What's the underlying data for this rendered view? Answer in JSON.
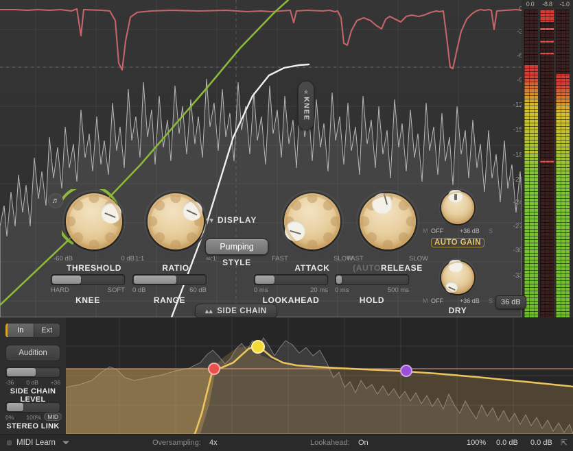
{
  "meters": {
    "values": [
      "0.0",
      "-8.8",
      "-1.0"
    ],
    "scale_labels": [
      "0",
      "-3",
      "-6",
      "-9",
      "-12",
      "-15",
      "-18",
      "-21",
      "-24",
      "-27",
      "-30",
      "-33"
    ],
    "gain_badge": "36 dB"
  },
  "graph": {
    "knee_tab_label": "KNEE",
    "knee_tab_icon": "chevron-double-left-icon",
    "headphone_icon": "headphone-icon"
  },
  "controls": {
    "threshold": {
      "name": "THRESHOLD",
      "min": "-60 dB",
      "max": "0 dB"
    },
    "ratio": {
      "name": "RATIO",
      "min": "1:1",
      "max": "∞:1"
    },
    "attack": {
      "name": "ATTACK",
      "min": "FAST",
      "max": "SLOW"
    },
    "release": {
      "name": "RELEASE",
      "prefix": "(AUTO",
      "min": "FAST",
      "max": "SLOW"
    },
    "knee": {
      "name": "KNEE",
      "min": "HARD",
      "max": "SOFT"
    },
    "range": {
      "name": "RANGE",
      "min": "0 dB",
      "max": "60 dB"
    },
    "lookahead": {
      "name": "LOOKAHEAD",
      "min": "0 ms",
      "max": "20 ms"
    },
    "hold": {
      "name": "HOLD",
      "min": "0 ms",
      "max": "500 ms"
    },
    "style": {
      "name": "STYLE",
      "value": "Pumping"
    },
    "auto_gain": {
      "name": "AUTO GAIN",
      "mute": "M",
      "state": "OFF",
      "max": "+36 dB",
      "solo": "S"
    },
    "dry": {
      "name": "DRY",
      "mute": "M",
      "state": "OFF",
      "max": "+36 dB",
      "solo": "S"
    },
    "display_button": {
      "label": "DISPLAY",
      "icon": "chevron-double-down-icon"
    },
    "sidechain_button": {
      "label": "SIDE CHAIN",
      "icon": "chevron-double-up-icon"
    }
  },
  "sidechain": {
    "source_tabs": [
      {
        "label": "In",
        "active": true
      },
      {
        "label": "Ext",
        "active": false
      }
    ],
    "audition_label": "Audition",
    "level": {
      "name": "SIDE CHAIN LEVEL",
      "min": "-36",
      "mid": "0 dB",
      "max": "+36"
    },
    "stereo_link": {
      "name": "STEREO LINK",
      "min": "0%",
      "mid": "100%",
      "tag": "MID"
    }
  },
  "footer": {
    "midi_learn": "MIDI Learn",
    "oversampling_label": "Oversampling:",
    "oversampling_value": "4x",
    "lookahead_label": "Lookahead:",
    "lookahead_value": "On",
    "zoom": "100%",
    "in_level": "0.0 dB",
    "out_level": "0.0 dB",
    "resize_icon": "resize-handle-icon"
  },
  "colors": {
    "knob": "#e0c28f",
    "threshold_arc": "#8db83a",
    "gain_reduction_curve": "#c4656a",
    "transfer_curve": "#f2f0ea",
    "eq_curve": "#ecc45e",
    "accent": "#d9a330",
    "band_red": "#e8504a",
    "band_yellow": "#f5da35",
    "band_purple": "#9b4fd6"
  }
}
